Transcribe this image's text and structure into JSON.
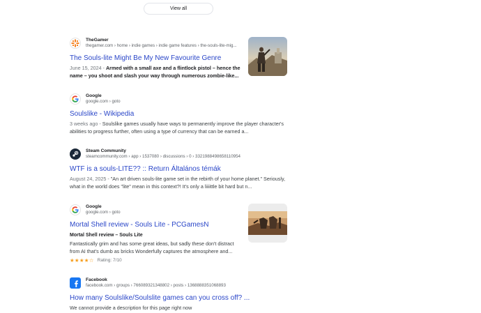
{
  "view_all": "View all",
  "results": [
    {
      "site": "TheGamer",
      "crumb": "thegamer.com › home › indie games › indie game features › the-souls-lite-mig...",
      "title": "The Souls-lite Might Be My New Favourite Genre",
      "date": "June 15, 2024",
      "date_sep": " - ",
      "snippet": "Armed with a small axe and a flintlock pistol – hence the name – you shoot and slash your way through numerous zombie-like...",
      "favicon": "thegamer-logo-icon",
      "accent": "#f58220"
    },
    {
      "site": "Google",
      "crumb": "google.com › goto",
      "title": "Soulslike - Wikipedia",
      "date": "3 weeks ago",
      "date_sep": " - ",
      "snippet": "Soulslike games usually have ways to permanently improve the player character's abilities to progress further, often using a type of currency that can be earned a...",
      "favicon": "google-logo-icon"
    },
    {
      "site": "Steam Community",
      "crumb": "steamcommunity.com › app › 1537080 › discussions › 0 › 3321988498658110954",
      "title": "WTF is a souls-LITE?? :: Return Általános témák",
      "date": "August 24, 2025",
      "date_sep": " - ",
      "snippet": "\"An art driven souls-lite game set in the rebirth of your home planet.\" Seriously, what in the world does \"lite\" mean in this context?! It's only a liiiittle bit hard but n...",
      "favicon": "steam-logo-icon",
      "accent": "#1b2838"
    },
    {
      "site": "Google",
      "crumb": "google.com › goto",
      "title": "Mortal Shell review - Souls Lite - PCGamesN",
      "subtitle": "Mortal Shell review – Souls Lite",
      "snippet": "Fantastically grim and has some great ideas, but sadly these don't distract from AI that's dumb as bricks Wonderfully captures the atmosphere and...",
      "rating_stars": "★★★★☆",
      "rating_text": "Rating: 7/10",
      "rating_value": 0.7,
      "favicon": "google-logo-icon",
      "star_color": "#f59d1c"
    },
    {
      "site": "Facebook",
      "crumb": "facebook.com › groups › 766089321348802 › posts › 1368888351068893",
      "title": "How many Soulslike/Soulslite games can you cross off? ...",
      "snippet": "We cannot provide a description for this page right now",
      "favicon": "facebook-logo-icon",
      "accent": "#1877f2"
    }
  ],
  "colors": {
    "link": "#2a46c8",
    "meta": "#5f6368"
  }
}
